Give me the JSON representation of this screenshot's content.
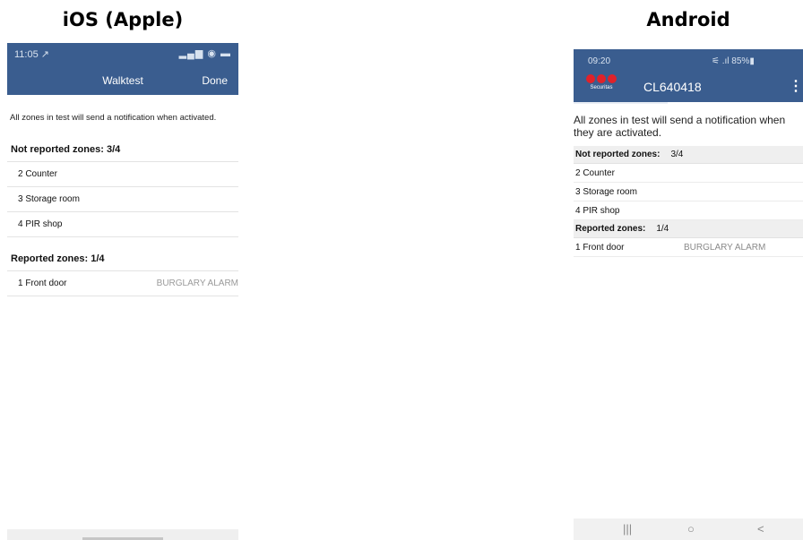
{
  "labels": {
    "ios": "iOS (Apple)",
    "android": "Android"
  },
  "ios": {
    "status": {
      "time": "11:05 ↗",
      "indicators": "▂▄▆ ◉ ▬"
    },
    "nav": {
      "title": "Walktest",
      "done": "Done"
    },
    "info": "All zones in test will send a notification when activated.",
    "not_reported_header": "Not reported zones: 3/4",
    "not_reported": [
      "2 Counter",
      "3 Storage room",
      "4 PIR shop"
    ],
    "reported_header": "Reported zones: 1/4",
    "reported": [
      {
        "name": "1 Front door",
        "status": "BURGLARY ALARM"
      }
    ]
  },
  "android": {
    "status": {
      "time": "09:20",
      "indicators": "⚟ .ıl 85%▮"
    },
    "logo_text": "Securitas",
    "title": "CL640418",
    "menu_icon": "⋮",
    "info": "All zones in test will send a notification when they are activated.",
    "not_reported_label": "Not reported zones:",
    "not_reported_count": "3/4",
    "not_reported": [
      "2 Counter",
      "3 Storage room",
      "4 PIR shop"
    ],
    "reported_label": "Reported zones:",
    "reported_count": "1/4",
    "reported": [
      {
        "name": "1 Front door",
        "status": "BURGLARY ALARM"
      }
    ],
    "nav": {
      "recents": "|||",
      "home": "○",
      "back": "<"
    }
  },
  "colors": {
    "header": "#3a5d8f",
    "logo_red": "#e0222a"
  }
}
